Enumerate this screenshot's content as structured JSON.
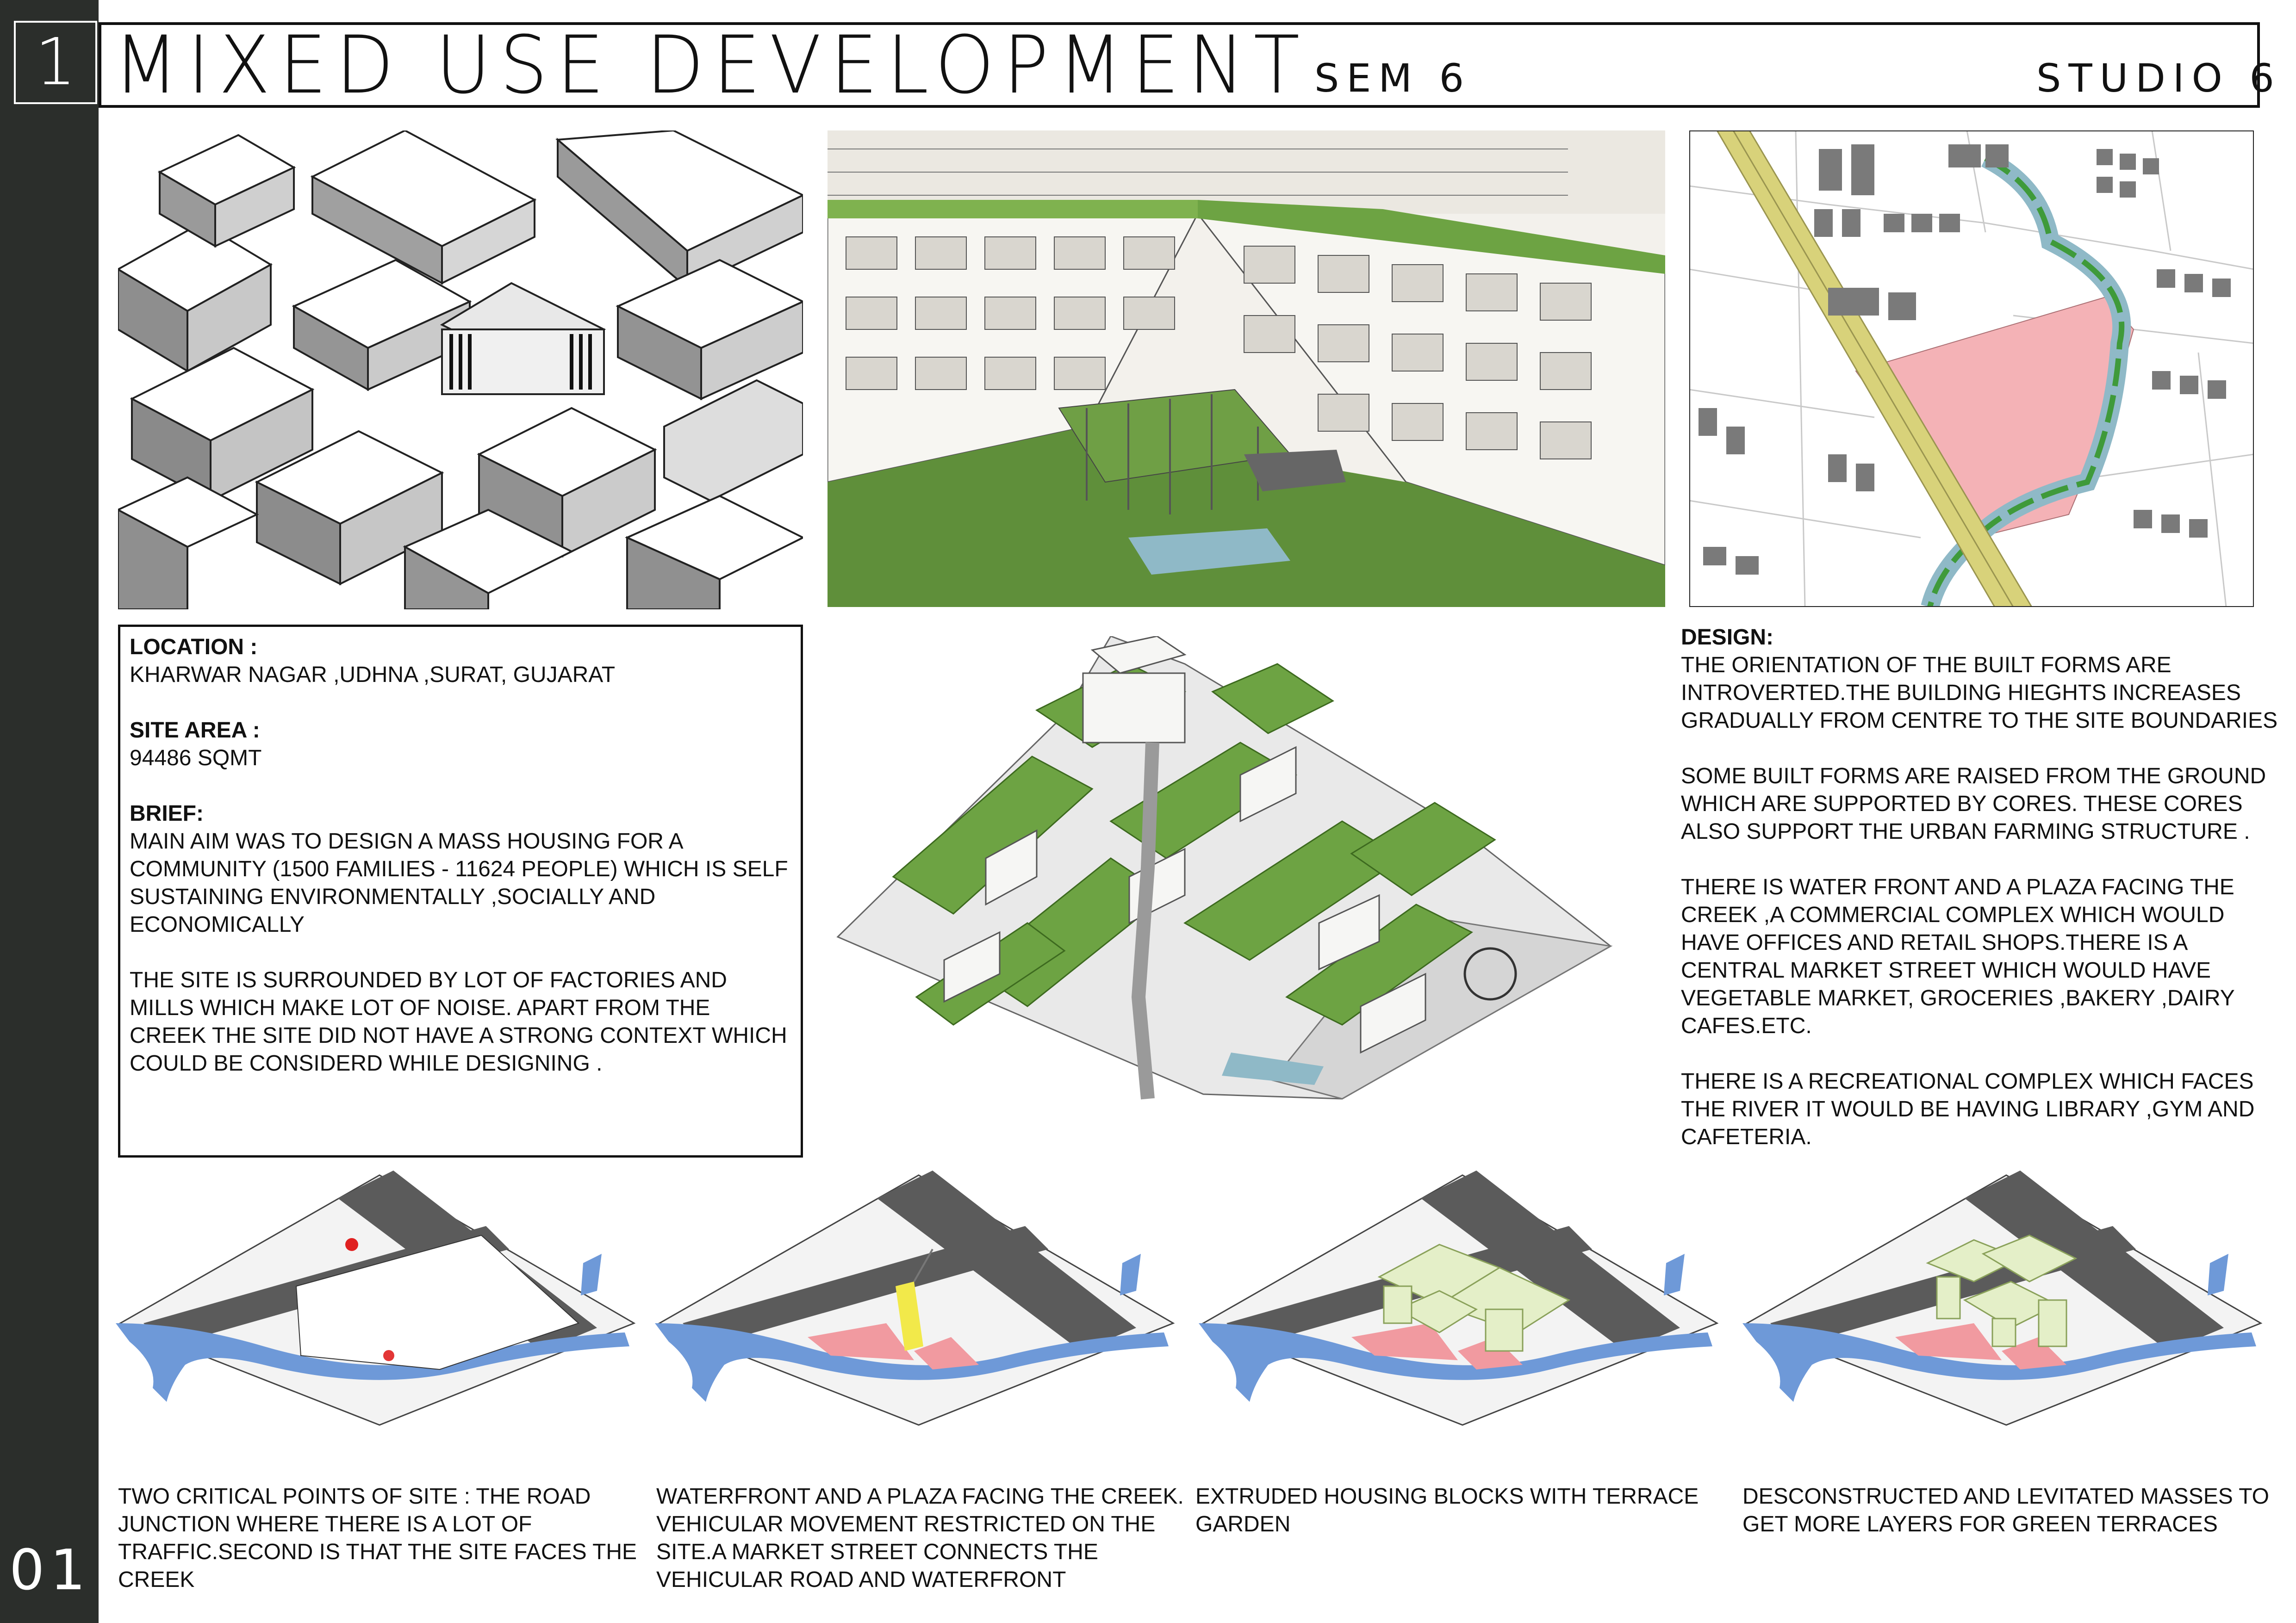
{
  "header": {
    "sheet_number": "1",
    "title": "MIXED USE DEVELOPMENT",
    "semester": "SEM 6",
    "studio": "STUDIO 6",
    "page_number": "01"
  },
  "info": {
    "location_label": "LOCATION :",
    "location_value": "KHARWAR NAGAR ,UDHNA ,SURAT, GUJARAT",
    "site_area_label": "SITE AREA :",
    "site_area_value": "94486 SQMT",
    "brief_label": "BRIEF:",
    "brief_p1": "MAIN AIM WAS TO DESIGN A MASS HOUSING FOR A COMMUNITY (1500 FAMILIES - 11624 PEOPLE) WHICH IS SELF SUSTAINING ENVIRONMENTALLY ,SOCIALLY AND ECONOMICALLY",
    "brief_p2": "THE SITE IS SURROUNDED BY LOT OF FACTORIES AND MILLS WHICH MAKE LOT OF NOISE. APART FROM THE CREEK THE SITE DID NOT HAVE A STRONG CONTEXT WHICH COULD BE CONSIDERD WHILE DESIGNING ."
  },
  "design": {
    "label": "DESIGN:",
    "p1": "THE ORIENTATION OF THE BUILT FORMS ARE INTROVERTED.THE BUILDING HIEGHTS INCREASES GRADUALLY FROM CENTRE TO THE SITE BOUNDARIES",
    "p2": "SOME BUILT FORMS ARE RAISED FROM THE GROUND WHICH ARE SUPPORTED BY CORES. THESE CORES ALSO SUPPORT THE URBAN FARMING STRUCTURE .",
    "p3": "THERE IS WATER FRONT AND A PLAZA FACING THE CREEK ,A COMMERCIAL COMPLEX WHICH WOULD HAVE OFFICES AND RETAIL SHOPS.THERE IS A CENTRAL MARKET STREET WHICH WOULD HAVE VEGETABLE MARKET, GROCERIES ,BAKERY ,DAIRY CAFES.ETC.",
    "p4": "THERE IS A RECREATIONAL COMPLEX WHICH FACES THE RIVER IT WOULD BE HAVING LIBRARY ,GYM AND CAFETERIA."
  },
  "captions": [
    "TWO CRITICAL POINTS OF SITE : THE ROAD JUNCTION WHERE THERE IS A LOT OF TRAFFIC.SECOND IS THAT THE SITE FACES THE CREEK",
    "WATERFRONT AND A PLAZA FACING THE CREEK. VEHICULAR MOVEMENT RESTRICTED ON THE SITE.A MARKET STREET CONNECTS THE VEHICULAR ROAD AND WATERFRONT",
    "EXTRUDED HOUSING BLOCKS WITH TERRACE GARDEN",
    "DESCONSTRUCTED AND LEVITATED MASSES TO GET MORE LAYERS FOR GREEN TERRACES"
  ],
  "colors": {
    "sidebar": "#2b2e2b",
    "greenery": "#6da343",
    "water": "#6e99d8",
    "site": "#f4b2b6",
    "road": "#555555",
    "highway": "#d8d27a"
  }
}
